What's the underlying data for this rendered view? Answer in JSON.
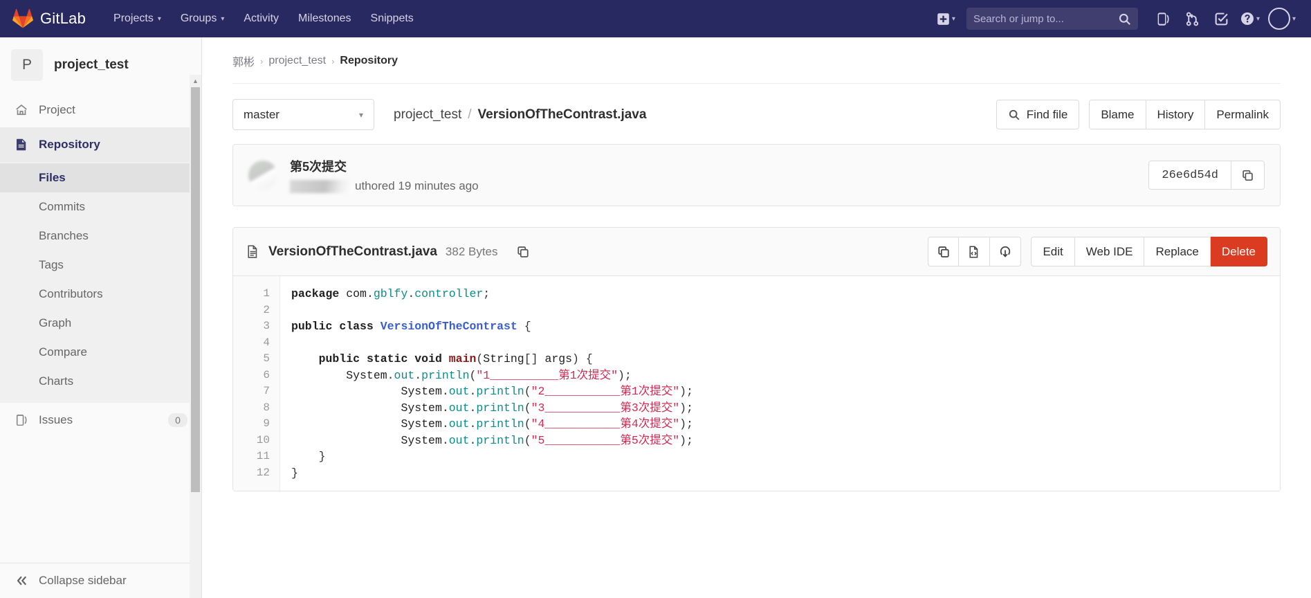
{
  "navbar": {
    "brand": "GitLab",
    "links": [
      {
        "label": "Projects",
        "has_caret": true
      },
      {
        "label": "Groups",
        "has_caret": true
      },
      {
        "label": "Activity",
        "has_caret": false
      },
      {
        "label": "Milestones",
        "has_caret": false
      },
      {
        "label": "Snippets",
        "has_caret": false
      }
    ],
    "search_placeholder": "Search or jump to...",
    "icons": [
      "plus-icon",
      "search-icon",
      "issues-icon",
      "merge-requests-icon",
      "todos-icon",
      "help-icon",
      "avatar"
    ]
  },
  "sidebar": {
    "project_initial": "P",
    "project_name": "project_test",
    "items": [
      {
        "label": "Project",
        "icon": "home-icon",
        "active": false
      },
      {
        "label": "Repository",
        "icon": "document-icon",
        "active": true
      }
    ],
    "sub_items": [
      {
        "label": "Files",
        "active": true
      },
      {
        "label": "Commits",
        "active": false
      },
      {
        "label": "Branches",
        "active": false
      },
      {
        "label": "Tags",
        "active": false
      },
      {
        "label": "Contributors",
        "active": false
      },
      {
        "label": "Graph",
        "active": false
      },
      {
        "label": "Compare",
        "active": false
      },
      {
        "label": "Charts",
        "active": false
      }
    ],
    "issues": {
      "label": "Issues",
      "count": "0",
      "icon": "issues-icon"
    },
    "collapse": {
      "label": "Collapse sidebar",
      "icon": "double-chevron-left-icon"
    }
  },
  "breadcrumb": [
    {
      "label": "郭彬",
      "current": false
    },
    {
      "label": "project_test",
      "current": false
    },
    {
      "label": "Repository",
      "current": true
    }
  ],
  "file_bar": {
    "branch": "master",
    "path_dir": "project_test",
    "path_sep": "/",
    "path_file": "VersionOfTheContrast.java",
    "find_file": "Find file",
    "blame": "Blame",
    "history": "History",
    "permalink": "Permalink"
  },
  "commit": {
    "message": "第5次提交",
    "authored_text": "uthored 19 minutes ago",
    "sha": "26e6d54d",
    "copy_icon": "copy-icon"
  },
  "file_view": {
    "name": "VersionOfTheContrast.java",
    "size": "382 Bytes",
    "file_icon": "document-icon",
    "copy_path_icon": "copy-icon",
    "icon_buttons": [
      "copy-icon",
      "raw-file-icon",
      "download-icon"
    ],
    "edit": "Edit",
    "web_ide": "Web IDE",
    "replace": "Replace",
    "delete": "Delete",
    "line_numbers": [
      "1",
      "2",
      "3",
      "4",
      "5",
      "6",
      "7",
      "8",
      "9",
      "10",
      "11",
      "12"
    ],
    "code_lines": [
      {
        "n": 1,
        "text": "package com.gblfy.controller;"
      },
      {
        "n": 2,
        "text": ""
      },
      {
        "n": 3,
        "text": "public class VersionOfTheContrast {"
      },
      {
        "n": 4,
        "text": ""
      },
      {
        "n": 5,
        "text": "    public static void main(String[] args) {"
      },
      {
        "n": 6,
        "text": "        System.out.println(\"1__________第1次提交\");"
      },
      {
        "n": 7,
        "text": "                System.out.println(\"2___________第1次提交\");"
      },
      {
        "n": 8,
        "text": "                System.out.println(\"3___________第3次提交\");"
      },
      {
        "n": 9,
        "text": "                System.out.println(\"4___________第4次提交\");"
      },
      {
        "n": 10,
        "text": "                System.out.println(\"5___________第5次提交\");"
      },
      {
        "n": 11,
        "text": "    }"
      },
      {
        "n": 12,
        "text": "}"
      }
    ]
  },
  "colors": {
    "navbar_bg": "#292961",
    "brand_orange": "#e24329",
    "accent_purple": "#2e2e66",
    "danger_red": "#db3b21",
    "string_red": "#d32a52",
    "teal": "#0b8b8b"
  }
}
